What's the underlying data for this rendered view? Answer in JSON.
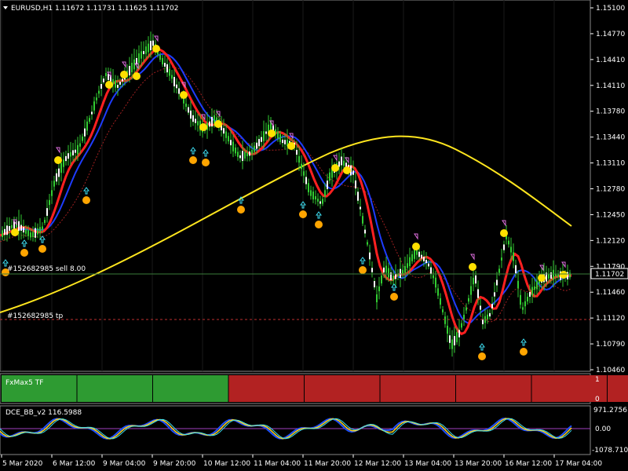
{
  "header": {
    "symbol_line": "EURUSD,H1  1.11672 1.11731 1.11625 1.11702"
  },
  "price_axis": {
    "ticks": [
      "1.15100",
      "1.14770",
      "1.14410",
      "1.14110",
      "1.13780",
      "1.13440",
      "1.13110",
      "1.12780",
      "1.12450",
      "1.12120",
      "1.11790",
      "1.11460",
      "1.11120",
      "1.10790",
      "1.10460"
    ],
    "current_price": "1.11702"
  },
  "order_lines": {
    "sell_label": "#152682985 sell 8.00",
    "tp_label": "#152682985 tp"
  },
  "time_axis": {
    "labels": [
      "5 Mar 2020",
      "6 Mar 12:00",
      "9 Mar 04:00",
      "9 Mar 20:00",
      "10 Mar 12:00",
      "11 Mar 04:00",
      "11 Mar 20:00",
      "12 Mar 12:00",
      "13 Mar 04:00",
      "13 Mar 20:00",
      "16 Mar 12:00",
      "17 Mar 04:00"
    ]
  },
  "fxmax": {
    "title": "FxMax5 TF",
    "scale_top": "1",
    "scale_bottom": "0",
    "blocks": [
      "green",
      "green",
      "green",
      "red",
      "red",
      "red",
      "red",
      "red",
      "red",
      "red",
      "red"
    ],
    "colors": {
      "green": "#2e9b32",
      "red": "#b22222"
    }
  },
  "dce": {
    "title": "DCE_BB_v2 116.5988",
    "scale_top": "971.2756",
    "scale_mid": "0.00",
    "scale_bottom": "-1078.7104"
  },
  "colors": {
    "bull_candle": "#32cd32",
    "bear_candle": "#ffffff",
    "ma_fast": "#ff2020",
    "ma_blue": "#1e3cff",
    "ma_cyan": "#3cdcf0",
    "ma_yellow": "#ffe61e",
    "signal_up": "#ffa500",
    "signal_down": "#ffe000"
  },
  "icons": {
    "collapse": "triangle-down-icon",
    "arrow_up": "arrow-up-icon",
    "arrow_down": "arrow-down-icon"
  }
}
